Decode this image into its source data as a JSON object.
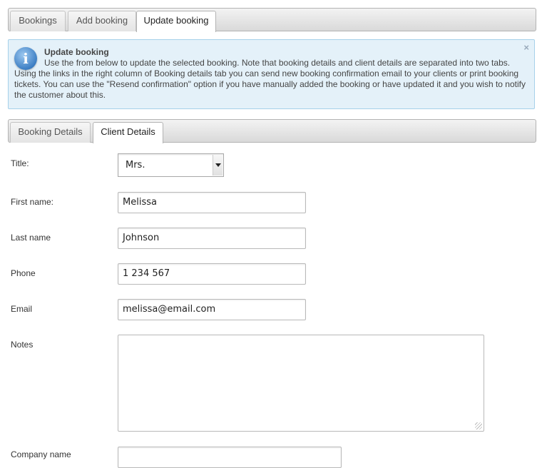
{
  "top_tabs": [
    {
      "label": "Bookings",
      "active": false
    },
    {
      "label": "Add booking",
      "active": false
    },
    {
      "label": "Update booking",
      "active": true
    }
  ],
  "info_box": {
    "icon": "info-icon",
    "icon_glyph": "i",
    "title": "Update booking",
    "text": "Use the from below to update the selected booking. Note that booking details and client details are separated into two tabs. Using the links in the right column of Booking details tab you can send new booking confirmation email to your clients or print booking tickets. You can use the \"Resend confirmation\" option if you have manually added the booking or have updated it and you wish to notify the customer about this.",
    "close_glyph": "×"
  },
  "sub_tabs": [
    {
      "label": "Booking Details",
      "active": false
    },
    {
      "label": "Client Details",
      "active": true
    }
  ],
  "form": {
    "title": {
      "label": "Title:",
      "value": "Mrs."
    },
    "first_name": {
      "label": "First name:",
      "value": "Melissa"
    },
    "last_name": {
      "label": "Last name",
      "value": "Johnson"
    },
    "phone": {
      "label": "Phone",
      "value": "1 234 567"
    },
    "email": {
      "label": "Email",
      "value": "melissa@email.com"
    },
    "notes": {
      "label": "Notes",
      "value": ""
    },
    "company_name": {
      "label": "Company name",
      "value": ""
    }
  },
  "colors": {
    "info_bg": "#e4f1f9",
    "info_border": "#a6d1ea",
    "icon_blue": "#3d7fc4"
  }
}
